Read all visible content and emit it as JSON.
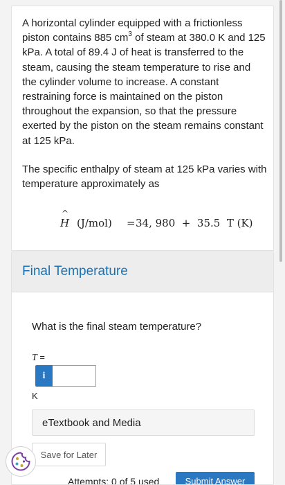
{
  "problem": {
    "paragraph1_a": "A horizontal cylinder equipped with a frictionless piston contains 885 cm",
    "paragraph1_sup": "3",
    "paragraph1_b": " of steam at 380.0 K and 125 kPa. A total of 89.4 J of heat is transferred to the steam, causing the steam temperature to rise and the cylinder volume to increase. A constant restraining force is maintained on the piston throughout the expansion, so that the pressure exerted by the piston on the steam remains constant at 125 kPa.",
    "paragraph2": "The specific enthalpy of steam at 125 kPa varies with temperature approximately as",
    "equation": {
      "hat": "^",
      "symbol": "H",
      "units": "(J/mol)",
      "equals": "=",
      "rhs": "34, 980  +  35.5  T (K)"
    }
  },
  "part": {
    "title": "Final Temperature",
    "question": "What is the final steam temperature?",
    "variable": "T",
    "variable_suffix": " =",
    "info_icon_glyph": "i",
    "input_value": "",
    "unit": "K",
    "etextbook_label": "eTextbook and Media",
    "save_label": "Save for Later",
    "attempts_text": "Attempts: 0 of 5 used",
    "submit_label": "Submit Answer"
  },
  "colors": {
    "accent": "#2b78c2",
    "title_blue": "#1a73b5",
    "header_bg": "#ededed"
  },
  "icons": {
    "info": "info-icon",
    "cookie": "cookie-icon"
  }
}
